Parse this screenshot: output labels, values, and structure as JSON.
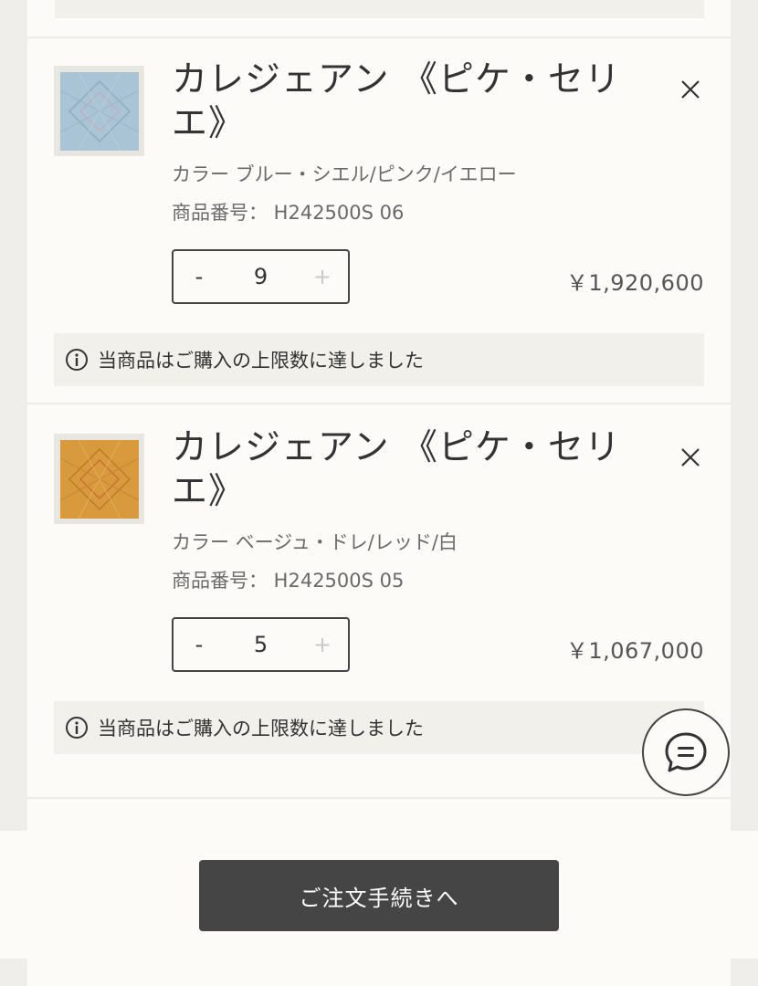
{
  "items": [
    {
      "title": "カレジェアン 《ピケ・セリエ》",
      "color": "カラー ブルー・シエル/ピンク/イエロー",
      "sku": "商品番号： H242500S 06",
      "quantity": "9",
      "minus": "-",
      "plus": "+",
      "price": "￥1,920,600",
      "limit_notice": "当商品はご購入の上限数に達しました",
      "swatch_color": "#a9c4d4"
    },
    {
      "title": "カレジェアン 《ピケ・セリエ》",
      "color": "カラー ベージュ・ドレ/レッド/白",
      "sku": "商品番号： H242500S 05",
      "quantity": "5",
      "minus": "-",
      "plus": "+",
      "price": "￥1,067,000",
      "limit_notice": "当商品はご購入の上限数に達しました",
      "swatch_color": "#d99a3e"
    }
  ],
  "checkout_label": "ご注文手続きへ",
  "icons": {
    "remove": "close-icon",
    "info": "info-icon",
    "chat": "chat-icon"
  },
  "colors": {
    "page_bg": "#efeeea",
    "panel_bg": "#fcfbf7",
    "notice_bg": "#f2f0ea",
    "button_bg": "#454545"
  }
}
